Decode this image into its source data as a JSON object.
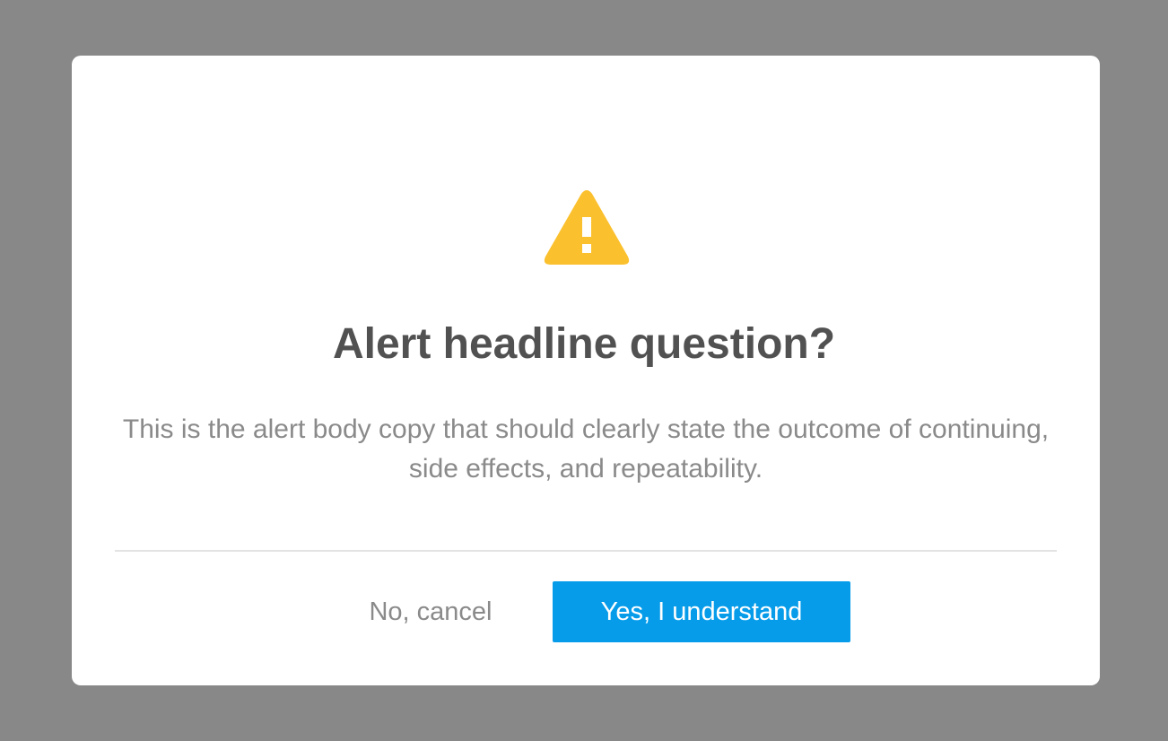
{
  "alert": {
    "icon": "warning-triangle-icon",
    "icon_color": "#fbc02d",
    "headline": "Alert headline question?",
    "body": "This is the alert body copy that should clearly state the outcome of continuing, side effects, and repeatability."
  },
  "actions": {
    "cancel_label": "No, cancel",
    "confirm_label": "Yes, I understand",
    "confirm_color": "#069cea"
  },
  "colors": {
    "backdrop": "#888888",
    "dialog": "#ffffff",
    "headline_text": "#515151",
    "body_text": "#8a8a8a"
  }
}
